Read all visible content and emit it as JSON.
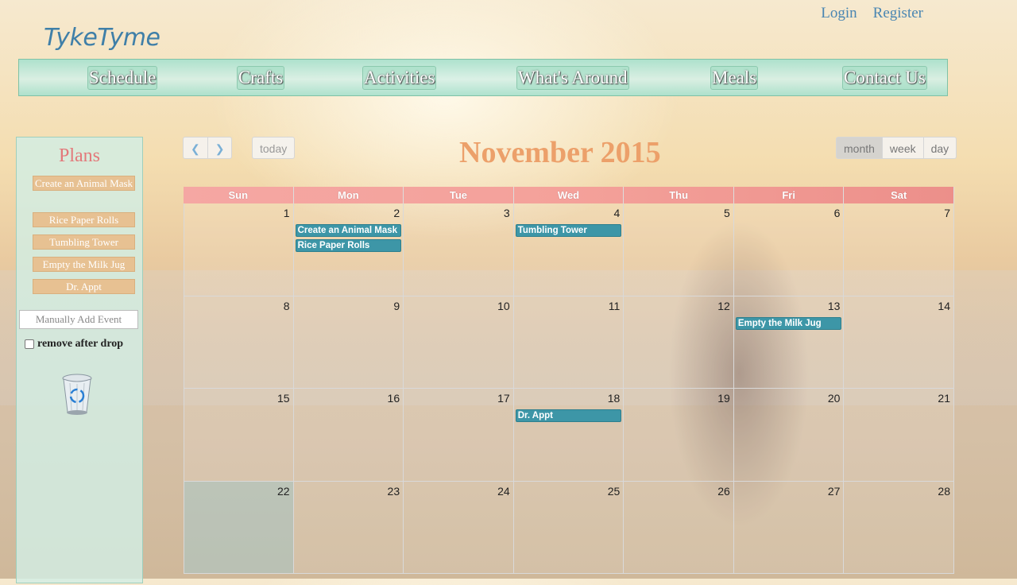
{
  "header": {
    "logo": "TykeTyme",
    "login": "Login",
    "register": "Register"
  },
  "nav": [
    {
      "label": "Schedule"
    },
    {
      "label": "Crafts"
    },
    {
      "label": "Activities"
    },
    {
      "label": "What's Around"
    },
    {
      "label": "Meals"
    },
    {
      "label": "Contact Us"
    }
  ],
  "sidebar": {
    "title": "Plans",
    "plans": [
      {
        "label": "Create an Animal Mask"
      },
      {
        "label": "Rice Paper Rolls"
      },
      {
        "label": "Tumbling Tower"
      },
      {
        "label": "Empty the Milk Jug"
      },
      {
        "label": "Dr. Appt"
      }
    ],
    "add_placeholder": "Manually Add Event",
    "remove_label": "remove after drop",
    "trash_icon": "recycle-bin-icon"
  },
  "calendar": {
    "title": "November 2015",
    "prev_icon": "chevron-left-icon",
    "next_icon": "chevron-right-icon",
    "today_label": "today",
    "views": [
      "month",
      "week",
      "day"
    ],
    "active_view": "month",
    "weekdays": [
      "Sun",
      "Mon",
      "Tue",
      "Wed",
      "Thu",
      "Fri",
      "Sat"
    ],
    "weeks": [
      [
        1,
        2,
        3,
        4,
        5,
        6,
        7
      ],
      [
        8,
        9,
        10,
        11,
        12,
        13,
        14
      ],
      [
        15,
        16,
        17,
        18,
        19,
        20,
        21
      ],
      [
        22,
        23,
        24,
        25,
        26,
        27,
        28
      ]
    ],
    "highlighted_day": 22,
    "events": [
      {
        "title": "Create an Animal Mask",
        "day": 2
      },
      {
        "title": "Rice Paper Rolls",
        "day": 2
      },
      {
        "title": "Tumbling Tower",
        "day": 4
      },
      {
        "title": "Empty the Milk Jug",
        "day": 13
      },
      {
        "title": "Dr. Appt",
        "day": 18
      }
    ]
  },
  "colors": {
    "accent_title": "#eca06a",
    "event_bg": "#3d96a7",
    "plan_bg": "#e7c192",
    "header_row": "#f4a19a"
  }
}
